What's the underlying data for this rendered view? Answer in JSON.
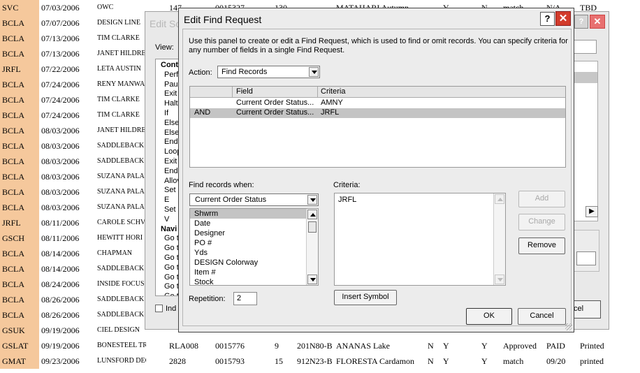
{
  "background_table": {
    "rows": [
      [
        "SVC",
        "07/03/2006",
        "OWC",
        "147",
        "0015327",
        "130",
        "",
        "MATAHARI Autumn",
        "",
        "Y",
        "N",
        "match",
        "N/A",
        "TBD"
      ],
      [
        "BCLA",
        "07/07/2006",
        "DESIGN LINE",
        "",
        "",
        "",
        "",
        "",
        "",
        "",
        "",
        "",
        "",
        ""
      ],
      [
        "BCLA",
        "07/13/2006",
        "TIM CLARKE",
        "",
        "",
        "",
        "",
        "",
        "",
        "",
        "",
        "",
        "",
        ""
      ],
      [
        "BCLA",
        "07/13/2006",
        "JANET HILDRE",
        "",
        "",
        "",
        "",
        "",
        "",
        "",
        "",
        "",
        "",
        ""
      ],
      [
        "JRFL",
        "07/22/2006",
        "LETA AUSTIN",
        "",
        "",
        "",
        "",
        "",
        "",
        "",
        "",
        "",
        "",
        ""
      ],
      [
        "BCLA",
        "07/24/2006",
        "RENY MANWA",
        "",
        "",
        "",
        "",
        "",
        "",
        "",
        "",
        "",
        "",
        ""
      ],
      [
        "BCLA",
        "07/24/2006",
        "TIM CLARKE",
        "",
        "",
        "",
        "",
        "",
        "",
        "",
        "",
        "",
        "",
        ""
      ],
      [
        "BCLA",
        "07/24/2006",
        "TIM CLARKE",
        "",
        "",
        "",
        "",
        "",
        "",
        "",
        "",
        "",
        "",
        ""
      ],
      [
        "BCLA",
        "08/03/2006",
        "JANET HILDRE",
        "",
        "",
        "",
        "",
        "",
        "",
        "",
        "",
        "",
        "",
        ""
      ],
      [
        "BCLA",
        "08/03/2006",
        "SADDLEBACK",
        "",
        "",
        "",
        "",
        "",
        "",
        "",
        "",
        "",
        "",
        ""
      ],
      [
        "BCLA",
        "08/03/2006",
        "SADDLEBACK",
        "",
        "",
        "",
        "",
        "",
        "",
        "",
        "",
        "",
        "",
        ""
      ],
      [
        "BCLA",
        "08/03/2006",
        "SUZANA PALA",
        "",
        "",
        "",
        "",
        "",
        "",
        "",
        "",
        "",
        "",
        ""
      ],
      [
        "BCLA",
        "08/03/2006",
        "SUZANA PALA",
        "",
        "",
        "",
        "",
        "",
        "",
        "",
        "",
        "",
        "",
        ""
      ],
      [
        "BCLA",
        "08/03/2006",
        "SUZANA PALA",
        "",
        "",
        "",
        "",
        "",
        "",
        "",
        "",
        "",
        "",
        ""
      ],
      [
        "JRFL",
        "08/11/2006",
        "CAROLE SCHV",
        "",
        "",
        "",
        "",
        "",
        "",
        "",
        "",
        "",
        "",
        ""
      ],
      [
        "GSCH",
        "08/11/2006",
        "HEWITT HORI",
        "",
        "",
        "",
        "",
        "",
        "",
        "",
        "",
        "",
        "",
        ""
      ],
      [
        "BCLA",
        "08/14/2006",
        "CHAPMAN",
        "",
        "",
        "",
        "",
        "",
        "",
        "",
        "",
        "",
        "",
        ""
      ],
      [
        "BCLA",
        "08/14/2006",
        "SADDLEBACK",
        "",
        "",
        "",
        "",
        "",
        "",
        "",
        "",
        "",
        "",
        ""
      ],
      [
        "BCLA",
        "08/24/2006",
        "INSIDE FOCUS",
        "",
        "",
        "",
        "",
        "",
        "",
        "",
        "",
        "",
        "",
        ""
      ],
      [
        "BCLA",
        "08/26/2006",
        "SADDLEBACK",
        "",
        "",
        "",
        "",
        "",
        "",
        "",
        "",
        "",
        "",
        ""
      ],
      [
        "BCLA",
        "08/26/2006",
        "SADDLEBACK",
        "",
        "",
        "",
        "",
        "",
        "",
        "",
        "",
        "",
        "",
        ""
      ],
      [
        "GSUK",
        "09/19/2006",
        "CIEL DESIGN",
        "",
        "",
        "",
        "",
        "",
        "",
        "",
        "",
        "",
        "",
        ""
      ],
      [
        "GSLAT",
        "09/19/2006",
        "BONESTEEL TROUT",
        "RLA008",
        "0015776",
        "9",
        "201N80-B",
        "ANANAS Lake",
        "N",
        "Y",
        "Y",
        "Approved",
        "PAID",
        "Printed"
      ],
      [
        "GMAT",
        "09/23/2006",
        "LUNSFORD DECOR",
        "2828",
        "0015793",
        "15",
        "912N23-B",
        "FLORESTA Cardamon",
        "N",
        "Y",
        "Y",
        "match",
        "09/20",
        "printed"
      ]
    ]
  },
  "back_window": {
    "title": "Edit Sc",
    "view_label": "View:",
    "script_steps": [
      {
        "text": "Cont",
        "header": true
      },
      {
        "text": "Perf",
        "header": false
      },
      {
        "text": "Paus",
        "header": false
      },
      {
        "text": "Exit",
        "header": false
      },
      {
        "text": "Halt",
        "header": false
      },
      {
        "text": "If",
        "header": false
      },
      {
        "text": "Else",
        "header": false
      },
      {
        "text": "Else",
        "header": false
      },
      {
        "text": "End",
        "header": false
      },
      {
        "text": "Loop",
        "header": false
      },
      {
        "text": "Exit",
        "header": false
      },
      {
        "text": "End",
        "header": false
      },
      {
        "text": "Allov",
        "header": false
      },
      {
        "text": "Set E",
        "header": false
      },
      {
        "text": "Set V",
        "header": false
      },
      {
        "text": "Navi",
        "header": true
      },
      {
        "text": "Go t",
        "header": false
      },
      {
        "text": "Go t",
        "header": false
      },
      {
        "text": "Go t",
        "header": false
      },
      {
        "text": "Go t",
        "header": false
      },
      {
        "text": "Go t",
        "header": false
      },
      {
        "text": "Go t",
        "header": false
      },
      {
        "text": "Go t",
        "header": false
      },
      {
        "text": "Go t",
        "header": false
      }
    ],
    "checkbox_label": "Ind",
    "cancel_fragment": "cel",
    "help_glyph": "?",
    "close_glyph": "✕",
    "scroll_glyph": "▶"
  },
  "dialog": {
    "title": "Edit Find Request",
    "help_glyph": "?",
    "close_glyph": "✕",
    "description": "Use this panel to create or edit a Find Request, which is used to find or omit records. You can specify criteria for any number of fields in a single Find Request.",
    "action_label": "Action:",
    "action_value": "Find Records",
    "table": {
      "col_field": "Field",
      "col_criteria": "Criteria",
      "rows": [
        {
          "op": "",
          "field": "Current Order Status...",
          "criteria": "AMNY",
          "selected": false
        },
        {
          "op": "AND",
          "field": "Current Order Status...",
          "criteria": "JRFL",
          "selected": true
        }
      ]
    },
    "find_when_label": "Find records when:",
    "field_select_value": "Current Order Status",
    "field_list": [
      "Shwrm",
      "Date",
      "Designer",
      "PO #",
      "Yds",
      "DESIGN Colorway",
      "Item #",
      "Stock"
    ],
    "field_list_selected": "Shwrm",
    "criteria_label": "Criteria:",
    "criteria_value": "JRFL",
    "buttons": {
      "add": "Add",
      "change": "Change",
      "remove": "Remove",
      "insert_symbol": "Insert Symbol",
      "ok": "OK",
      "cancel": "Cancel"
    },
    "repetition_label": "Repetition:",
    "repetition_value": "2"
  }
}
